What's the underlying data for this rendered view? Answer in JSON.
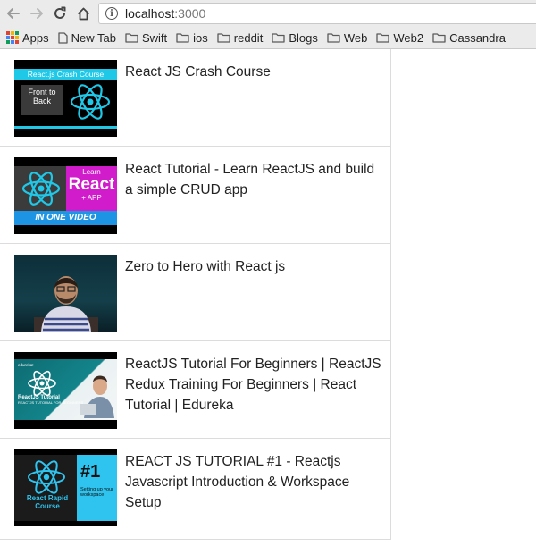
{
  "browser": {
    "url_host": "localhost",
    "url_port": ":3000",
    "bookmarks": [
      {
        "label": "Apps",
        "icon": "apps-grid-icon"
      },
      {
        "label": "New Tab",
        "icon": "page-icon"
      },
      {
        "label": "Swift",
        "icon": "folder-icon"
      },
      {
        "label": "ios",
        "icon": "folder-icon"
      },
      {
        "label": "reddit",
        "icon": "folder-icon"
      },
      {
        "label": "Blogs",
        "icon": "folder-icon"
      },
      {
        "label": "Web",
        "icon": "folder-icon"
      },
      {
        "label": "Web2",
        "icon": "folder-icon"
      },
      {
        "label": "Cassandra",
        "icon": "folder-icon"
      }
    ]
  },
  "videos": [
    {
      "title": "React JS Crash Course",
      "thumb": {
        "bar": "React.js Crash Course",
        "box": "Front to Back"
      }
    },
    {
      "title": "React Tutorial - Learn ReactJS and build a simple CRUD app",
      "thumb": {
        "learn": "Learn",
        "react": "React",
        "app": "+ APP",
        "bottom": "IN ONE VIDEO"
      }
    },
    {
      "title": "Zero to Hero with React js",
      "thumb": {}
    },
    {
      "title": "ReactJS Tutorial For Beginners | ReactJS Redux Training For Beginners | React Tutorial | Edureka",
      "thumb": {
        "tag": "edureka!",
        "label": "ReactJS Tutorial",
        "sub": "REACTJS TUTORIAL FOR BEGINNERS"
      }
    },
    {
      "title": "REACT JS TUTORIAL #1 - Reactjs Javascript Introduction & Workspace Setup",
      "thumb": {
        "num": "#1",
        "small": "Setting up your workspace",
        "label": "React Rapid Course"
      }
    }
  ],
  "colors": {
    "react_cyan": "#20c8e8",
    "chrome_bg": "#ecebeb",
    "folder": "#5a5a5a"
  }
}
